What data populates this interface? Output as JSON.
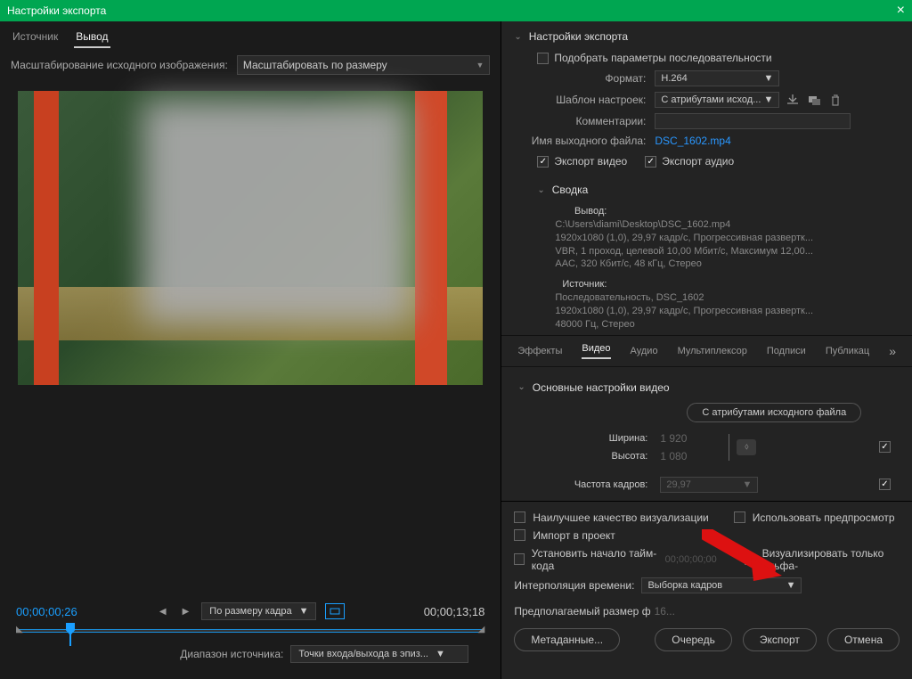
{
  "titlebar": {
    "title": "Настройки экспорта"
  },
  "left": {
    "tabs": {
      "source": "Источник",
      "output": "Вывод"
    },
    "scale_label": "Масштабирование исходного изображения:",
    "scale_value": "Масштабировать по размеру",
    "tc_current": "00;00;00;26",
    "tc_end": "00;00;13;18",
    "fit_label": "По размеру кадра",
    "range_label": "Диапазон источника:",
    "range_value": "Точки входа/выхода в эпиз..."
  },
  "export": {
    "title": "Настройки экспорта",
    "match_label": "Подобрать параметры последовательности",
    "format_label": "Формат:",
    "format_value": "H.264",
    "preset_label": "Шаблон настроек:",
    "preset_value": "С атрибутами исход...",
    "comments_label": "Комментарии:",
    "outname_label": "Имя выходного файла:",
    "outname_value": "DSC_1602.mp4",
    "export_video": "Экспорт видео",
    "export_audio": "Экспорт аудио",
    "summary_title": "Сводка",
    "summary_out_label": "Вывод:",
    "summary_out_line1": "C:\\Users\\diami\\Desktop\\DSC_1602.mp4",
    "summary_out_line2": "1920x1080 (1,0), 29,97 кадр/с, Прогрессивная развертк...",
    "summary_out_line3": "VBR, 1 проход, целевой 10,00 Мбит/с, Максимум 12,00...",
    "summary_out_line4": "AAC, 320 Кбит/с, 48 кГц, Стерео",
    "summary_src_label": "Источник:",
    "summary_src_line1": "Последовательность, DSC_1602",
    "summary_src_line2": "1920x1080 (1,0), 29,97 кадр/с, Прогрессивная развертк...",
    "summary_src_line3": "48000 Гц, Стерео",
    "tabs": {
      "effects": "Эффекты",
      "video": "Видео",
      "audio": "Аудио",
      "mux": "Мультиплексор",
      "caption": "Подписи",
      "publish": "Публикац"
    },
    "video_title": "Основные настройки видео",
    "match_source_btn": "С атрибутами исходного файла",
    "width_label": "Ширина:",
    "width_value": "1 920",
    "height_label": "Высота:",
    "height_value": "1 080",
    "fps_label": "Частота кадров:",
    "fps_value": "29,97"
  },
  "bottom": {
    "best_quality": "Наилучшее качество визуализации",
    "use_preview": "Использовать предпросмотр",
    "import": "Импорт в проект",
    "set_tc": "Установить начало тайм-кода",
    "tc_placeholder": "00;00;00;00",
    "render_alpha": "Визуализировать только альфа-",
    "interp_label": "Интерполяция времени:",
    "interp_value": "Выборка кадров",
    "est_label": "Предполагаемый размер ф",
    "est_value": "16...",
    "metadata": "Метаданные...",
    "queue": "Очередь",
    "export": "Экспорт",
    "cancel": "Отмена"
  }
}
